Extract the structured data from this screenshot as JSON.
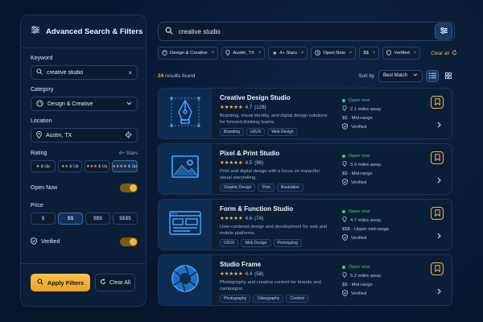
{
  "sidebar": {
    "title": "Advanced Search & Filters",
    "keyword": {
      "label": "Keyword",
      "value": "creative studio"
    },
    "category": {
      "label": "Category",
      "value": "Design & Creative"
    },
    "location": {
      "label": "Location",
      "value": "Austin, TX"
    },
    "rating": {
      "label": "Rating",
      "selected_text": "4+ Stars",
      "options": [
        {
          "stars": "★",
          "suffix": "& Up"
        },
        {
          "stars": "★★",
          "suffix": "& Up"
        },
        {
          "stars": "★★★",
          "suffix": "& Up"
        },
        {
          "stars": "★★★★",
          "suffix": "& Up"
        }
      ]
    },
    "open_now": {
      "label": "Open Now",
      "on": true
    },
    "price": {
      "label": "Price",
      "options": [
        "$",
        "$$",
        "$$$",
        "$$$$"
      ],
      "selected": "$$"
    },
    "verified": {
      "label": "Verified",
      "on": true
    },
    "apply_label": "Apply Filters",
    "clear_label": "Clear All"
  },
  "search": {
    "query": "creative studio"
  },
  "active_filters": {
    "chips": [
      "Design & Creative",
      "Austin, TX",
      "4+ Stars",
      "Open Now",
      "$$",
      "Verified"
    ],
    "clear_label": "Clear all"
  },
  "results": {
    "count": "24",
    "count_suffix": "results found",
    "sort_label": "Sort by",
    "sort_value": "Best Match"
  },
  "cards": [
    {
      "title": "Creative Design Studio",
      "stars": "★★★★★",
      "rating": "4.7",
      "reviews": "(128)",
      "desc": "Branding, visual identity, and digital design solutions for forward-thinking teams.",
      "tags": [
        "Branding",
        "UI/UX",
        "Web Design"
      ],
      "status": "Open now",
      "distance": "2.1 miles away",
      "price": "$$ - Mid-range",
      "verified": "Verified"
    },
    {
      "title": "Pixel & Print Studio",
      "stars": "★★★★★",
      "rating": "4.5",
      "reviews": "(96)",
      "desc": "Print and digital design with a focus on impactful visual storytelling.",
      "tags": [
        "Graphic Design",
        "Print",
        "Illustration"
      ],
      "status": "Open now",
      "distance": "3.4 miles away",
      "price": "$$ - Mid-range",
      "verified": "Verified"
    },
    {
      "title": "Form & Function Studio",
      "stars": "★★★★★",
      "rating": "4.6",
      "reviews": "(74)",
      "desc": "User-centered design and development for web and mobile platforms.",
      "tags": [
        "UI/UX",
        "Web Design",
        "Prototyping"
      ],
      "status": "Open now",
      "distance": "4.7 miles away",
      "price": "$$$ - Upper mid-range",
      "verified": "Verified"
    },
    {
      "title": "Studio Frame",
      "stars": "★★★★★",
      "rating": "4.4",
      "reviews": "(58)",
      "desc": "Photography and creative content for brands and campaigns.",
      "tags": [
        "Photography",
        "Videography",
        "Content"
      ],
      "status": "Open now",
      "distance": "5.2 miles away",
      "price": "$$ - Mid-range",
      "verified": "Verified"
    }
  ],
  "colors": {
    "accent": "#f4b63f",
    "open": "#37d37e",
    "panel": "#0b1e37",
    "background": "#06152a"
  }
}
